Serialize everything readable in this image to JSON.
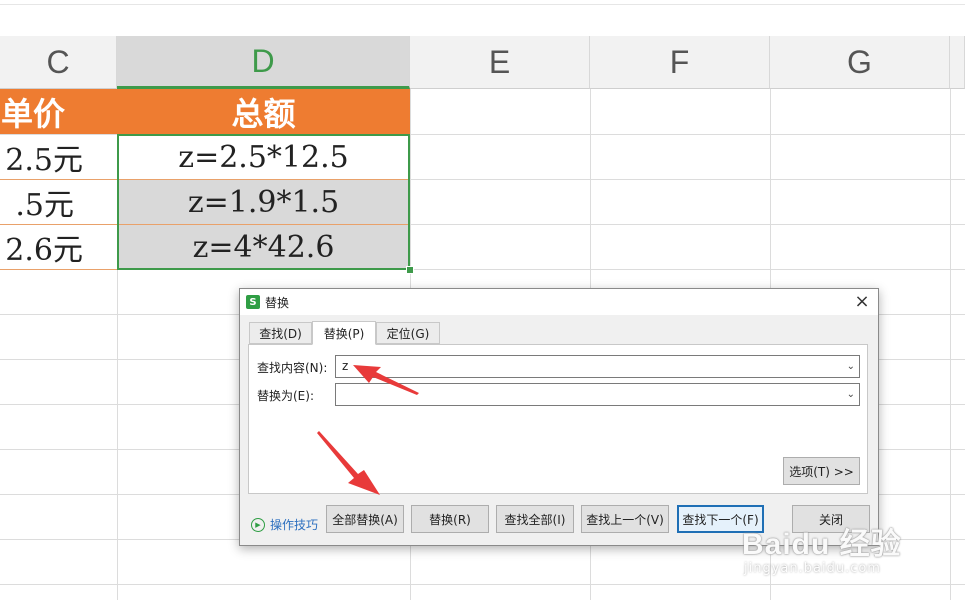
{
  "columns": {
    "c": "C",
    "d": "D",
    "e": "E",
    "f": "F",
    "g": "G"
  },
  "table": {
    "header_c": "单价",
    "header_d": "总额",
    "rows": [
      {
        "c": "2.5元",
        "d": "z=2.5*12.5"
      },
      {
        "c": ".5元",
        "d": "z=1.9*1.5"
      },
      {
        "c": "2.6元",
        "d": "z=4*42.6"
      }
    ]
  },
  "dialog": {
    "icon": "S",
    "title": "替换",
    "close": "×",
    "tabs": [
      "查找(D)",
      "替换(P)",
      "定位(G)"
    ],
    "find_label": "查找内容(N):",
    "find_value": "z",
    "replace_label": "替换为(E):",
    "replace_value": "",
    "options": "选项(T) >>",
    "tips": "操作技巧",
    "buttons": {
      "replace_all": "全部替换(A)",
      "replace": "替换(R)",
      "find_all": "查找全部(I)",
      "find_prev": "查找上一个(V)",
      "find_next": "查找下一个(F)",
      "close": "关闭"
    }
  },
  "colors": {
    "header_orange": "#ee7c31",
    "select_green": "#3e9a4a",
    "arrow_red": "#e83a3a"
  },
  "watermark": {
    "main": "Baidu 经验",
    "sub": "jingyan.baidu.com"
  }
}
